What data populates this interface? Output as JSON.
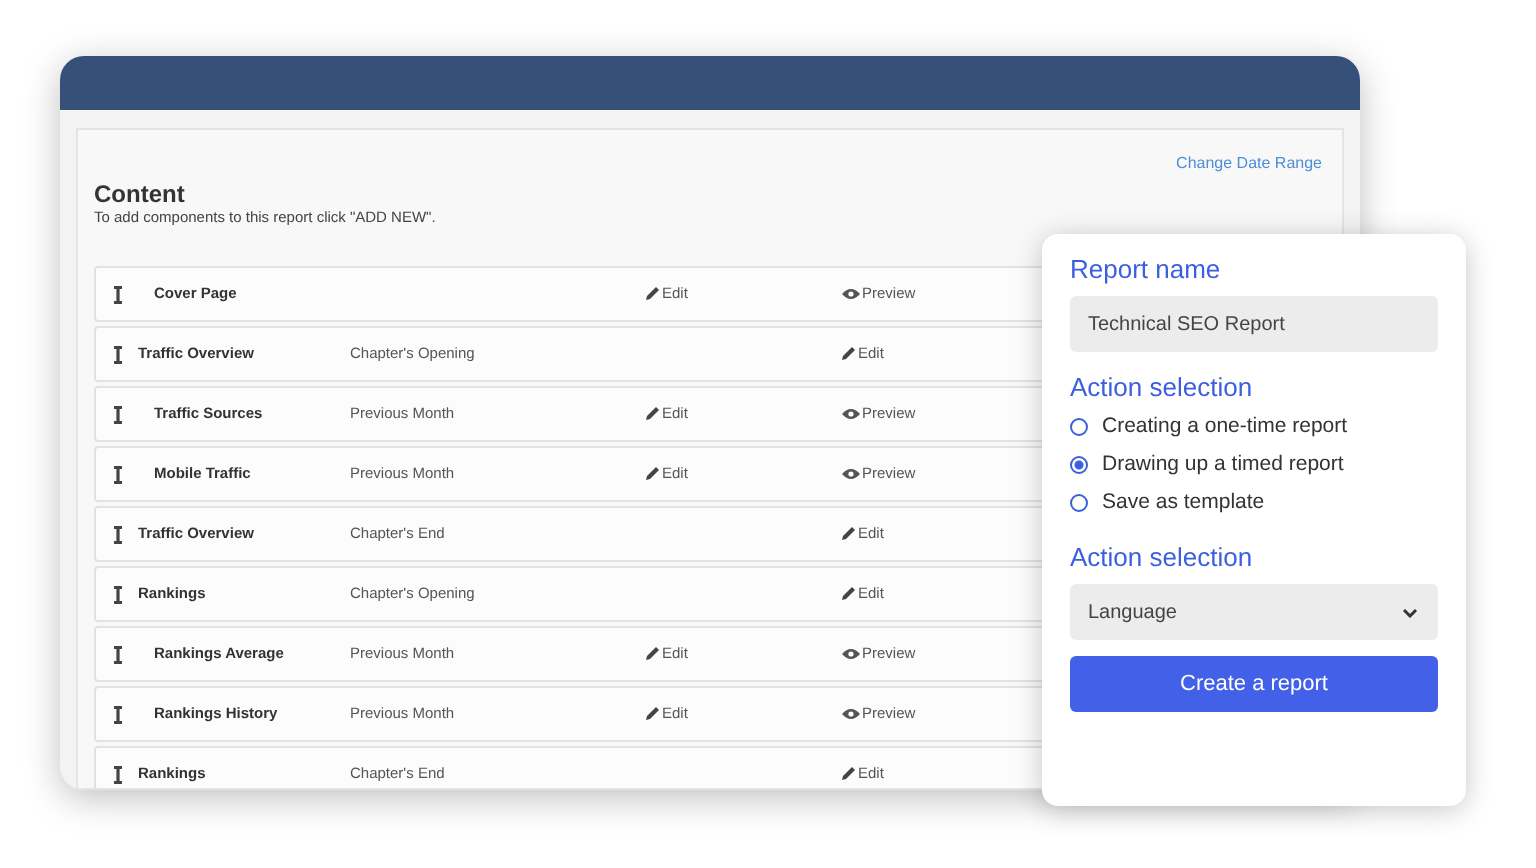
{
  "content": {
    "link": "Change Date Range",
    "title": "Content",
    "hint": "To add components to this report click \"ADD NEW\".",
    "rows": [
      {
        "name": "Cover Page",
        "indented": true,
        "period": "",
        "actions": [
          {
            "kind": "edit",
            "label": "Edit"
          },
          {
            "kind": "preview",
            "label": "Preview"
          }
        ]
      },
      {
        "name": "Traffic Overview",
        "indented": false,
        "period": "Chapter's Opening",
        "actions": [
          {
            "kind": "edit",
            "label": "Edit"
          }
        ]
      },
      {
        "name": "Traffic Sources",
        "indented": true,
        "period": "Previous Month",
        "actions": [
          {
            "kind": "edit",
            "label": "Edit"
          },
          {
            "kind": "preview",
            "label": "Preview"
          }
        ]
      },
      {
        "name": "Mobile Traffic",
        "indented": true,
        "period": "Previous Month",
        "actions": [
          {
            "kind": "edit",
            "label": "Edit"
          },
          {
            "kind": "preview",
            "label": "Preview"
          }
        ]
      },
      {
        "name": "Traffic Overview",
        "indented": false,
        "period": "Chapter's End",
        "actions": [
          {
            "kind": "edit",
            "label": "Edit"
          }
        ]
      },
      {
        "name": "Rankings",
        "indented": false,
        "period": "Chapter's Opening",
        "actions": [
          {
            "kind": "edit",
            "label": "Edit"
          }
        ]
      },
      {
        "name": "Rankings Average",
        "indented": true,
        "period": "Previous Month",
        "actions": [
          {
            "kind": "edit",
            "label": "Edit"
          },
          {
            "kind": "preview",
            "label": "Preview"
          }
        ]
      },
      {
        "name": "Rankings History",
        "indented": true,
        "period": "Previous Month",
        "actions": [
          {
            "kind": "edit",
            "label": "Edit"
          },
          {
            "kind": "preview",
            "label": "Preview"
          }
        ]
      },
      {
        "name": "Rankings",
        "indented": false,
        "period": "Chapter's End",
        "actions": [
          {
            "kind": "edit",
            "label": "Edit"
          }
        ]
      }
    ]
  },
  "form": {
    "name_label": "Report name",
    "name_value": "Technical SEO Report",
    "action_label": "Action selection",
    "options": [
      {
        "label": "Creating a one-time report",
        "selected": false
      },
      {
        "label": "Drawing up a timed report",
        "selected": true
      },
      {
        "label": "Save as template",
        "selected": false
      }
    ],
    "select_label": "Action selection",
    "select_value": "Language",
    "button": "Create a report"
  }
}
